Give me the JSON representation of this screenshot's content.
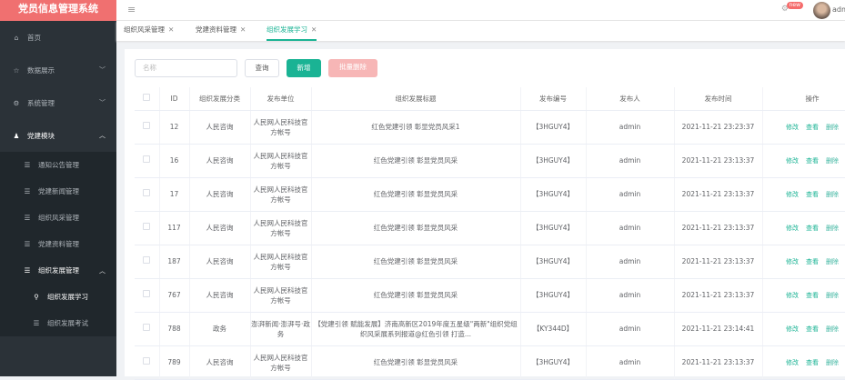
{
  "app": {
    "title": "党员信息管理系统"
  },
  "sidebar": {
    "items": [
      {
        "label": "首页",
        "icon": "home-icon"
      },
      {
        "label": "数据展示",
        "icon": "star-icon"
      },
      {
        "label": "系统管理",
        "icon": "gear-icon"
      },
      {
        "label": "党建模块",
        "icon": "user-icon"
      }
    ],
    "sub": [
      "通知公告管理",
      "党建新闻管理",
      "组织风采管理",
      "党建资料管理",
      "组织发展管理"
    ],
    "sub2": [
      "组织发展学习",
      "组织发展考试"
    ]
  },
  "header": {
    "badge": "new",
    "user": "admin"
  },
  "tabs": [
    "组织风采管理",
    "党建资料管理",
    "组织发展学习"
  ],
  "toolbar": {
    "search_placeholder": "名称",
    "query": "查询",
    "add": "新增",
    "batch_delete": "批量删除"
  },
  "table": {
    "columns": [
      "ID",
      "组织发展分类",
      "发布单位",
      "组织发展标题",
      "发布编号",
      "发布人",
      "发布时间",
      "操作"
    ],
    "ops": [
      "修改",
      "查看",
      "删除"
    ],
    "rows": [
      [
        "12",
        "人民咨询",
        "人民网人民科技官方帐号",
        "红色党建引领 彰显党员风采1",
        "【3HGUY4】",
        "admin",
        "2021-11-21 23:23:37"
      ],
      [
        "16",
        "人民咨询",
        "人民网人民科技官方帐号",
        "红色党建引领 彰显党员风采",
        "【3HGUY4】",
        "admin",
        "2021-11-21 23:13:37"
      ],
      [
        "17",
        "人民咨询",
        "人民网人民科技官方帐号",
        "红色党建引领 彰显党员风采",
        "【3HGUY4】",
        "admin",
        "2021-11-21 23:13:37"
      ],
      [
        "117",
        "人民咨询",
        "人民网人民科技官方帐号",
        "红色党建引领 彰显党员风采",
        "【3HGUY4】",
        "admin",
        "2021-11-21 23:13:37"
      ],
      [
        "187",
        "人民咨询",
        "人民网人民科技官方帐号",
        "红色党建引领 彰显党员风采",
        "【3HGUY4】",
        "admin",
        "2021-11-21 23:13:37"
      ],
      [
        "767",
        "人民咨询",
        "人民网人民科技官方帐号",
        "红色党建引领 彰显党员风采",
        "【3HGUY4】",
        "admin",
        "2021-11-21 23:13:37"
      ],
      [
        "788",
        "政务",
        "澎湃新闻·澎湃号·政务",
        "【党建引领 赋能发展】济南高新区2019年度五星级\"两新\"组织党组织风采展系列报道@红色引领 打造...",
        "【KY344D】",
        "admin",
        "2021-11-21 23:14:41"
      ],
      [
        "789",
        "人民咨询",
        "人民网人民科技官方帐号",
        "红色党建引领 彰显党员风采",
        "【3HGUY4】",
        "admin",
        "2021-11-21 23:13:37"
      ]
    ]
  }
}
